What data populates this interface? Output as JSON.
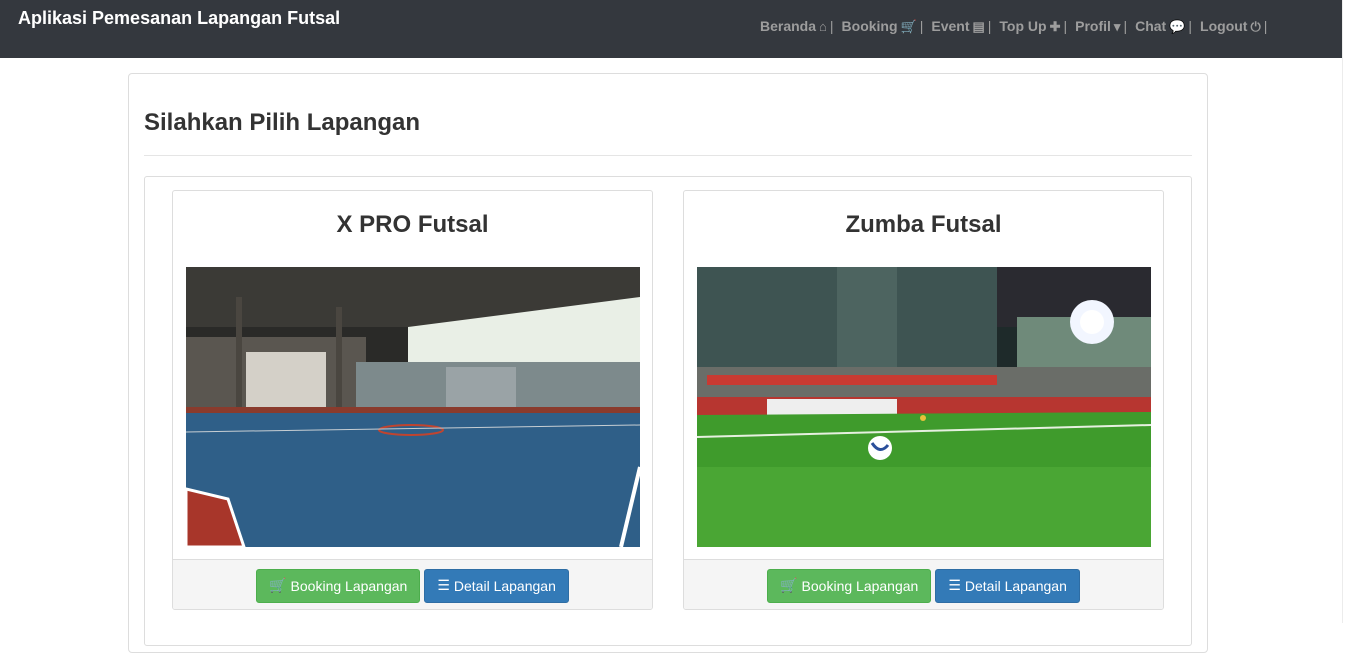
{
  "navbar": {
    "brand": "Aplikasi Pemesanan Lapangan Futsal",
    "items": [
      {
        "label": "Beranda",
        "icon": "home-icon",
        "glyph": "⌂"
      },
      {
        "label": "Booking",
        "icon": "cart-icon",
        "glyph": "🛒"
      },
      {
        "label": "Event",
        "icon": "list-alt-icon",
        "glyph": "▤"
      },
      {
        "label": "Top Up",
        "icon": "plus-icon",
        "glyph": "✚"
      },
      {
        "label": "Profil",
        "icon": "caret-down-icon",
        "glyph": "▾"
      },
      {
        "label": "Chat",
        "icon": "comment-icon",
        "glyph": "💬"
      },
      {
        "label": "Logout",
        "icon": "power-icon",
        "glyph": "⏻"
      }
    ],
    "separator": "|"
  },
  "main": {
    "title": "Silahkan Pilih Lapangan",
    "cards": [
      {
        "name": "X PRO Futsal",
        "booking_label": "Booking Lapangan",
        "detail_label": "Detail Lapangan"
      },
      {
        "name": "Zumba Futsal",
        "booking_label": "Booking Lapangan",
        "detail_label": "Detail Lapangan"
      }
    ]
  },
  "colors": {
    "navbar_bg": "#34383e",
    "button_green": "#5cb85c",
    "button_blue": "#337ab7"
  }
}
